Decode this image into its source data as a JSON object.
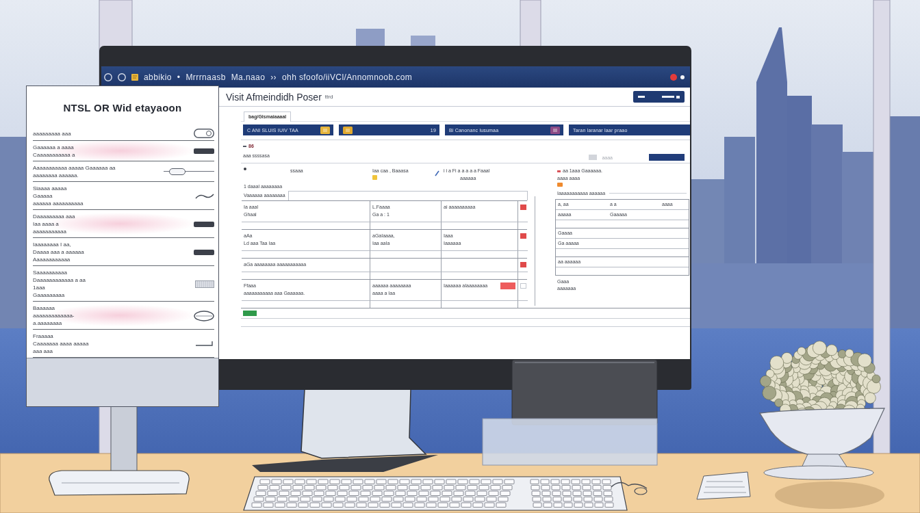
{
  "main_monitor": {
    "address_bar": {
      "segments": [
        "abbikio",
        "•",
        "Mrrrnaasb",
        "Ma.naao",
        "››",
        "ohh sfoofo/iiVCl/Annomnoob.com"
      ]
    },
    "page_title": "Visit Afmeindidh Poser",
    "title_note": "ttrd",
    "tabs": [
      {
        "label": "bag/Glsmaiaaaal",
        "selected": true
      }
    ],
    "header_bars": [
      {
        "label": "C ANI SLUIS IUIV TAA",
        "color": "#e5b43c",
        "kind": "label_icon"
      },
      {
        "label": "19",
        "color": "#e0a92e",
        "kind": "icon_label"
      },
      {
        "label": "Bl Canonanc lusumaa",
        "color": "#8c4a85",
        "kind": "label_icon"
      },
      {
        "label": "Taran laranar laar praao",
        "kind": "label"
      }
    ],
    "summary": {
      "marker": "86",
      "text": "aaa ssssasa",
      "link": "aaaa"
    },
    "form": {
      "intro": {
        "label": "ssaaa",
        "heading": "Iaa caa , Baaasa",
        "note": "i i a Fi a a a a a Faaal",
        "note_sub": "aaaaaa",
        "line": "1 daaal aaaaaaaa",
        "field_label": "Vaaaaaa aaaaaaaa"
      },
      "blocks": [
        {
          "flagged": true,
          "highlight_swatch": false,
          "cells": [
            [
              "Ia aaal",
              "Ghaal"
            ],
            [
              "L.Faaaa",
              "Ga a : 1"
            ],
            [
              "ai aaaaaaaaaa"
            ]
          ]
        },
        {
          "flagged": true,
          "highlight_swatch": false,
          "cells": [
            [
              "aAa",
              "Ld aaa Taa Iaa"
            ],
            [
              "aGaIaaaa,",
              "Iaa aaIa"
            ],
            [
              "Iaaa",
              "Iaaaaaa"
            ]
          ]
        },
        {
          "flagged": true,
          "highlight_swatch": false,
          "cells": [
            [
              "aGa aaaaaaaa aaaaaaaaaaa"
            ]
          ]
        },
        {
          "flagged": false,
          "highlight_swatch": true,
          "cells": [
            [
              "Ffaaa",
              "aaaaaaaaaaa aaa Gaaaaaa."
            ],
            [
              "aaaaaa aaaaaaaa",
              "aaaa a Iaa"
            ],
            [
              "Iaaaaaa aIaaaaaaaa"
            ]
          ]
        }
      ]
    },
    "side_panel": {
      "header": [
        "aa 1aaa Gaaaaaa.",
        "aaaa aaaa"
      ],
      "field_label": "Iaaaaaaaaaaa aaaaaa",
      "blocks": [
        {
          "rows": [
            [
              "a, aa",
              "a a",
              "aaaa"
            ],
            [
              "aaaaa",
              "Gaaaaa"
            ]
          ]
        },
        {
          "rows": [
            [
              "Gaaaa"
            ],
            [
              "Ga aaaaa"
            ]
          ]
        },
        {
          "rows": [
            [
              "aa aaaaaa"
            ]
          ]
        }
      ],
      "footer": [
        "Gaaa",
        "aaaaaaa"
      ]
    }
  },
  "side_monitor": {
    "title": "NTSL OR Wid etayaoon",
    "items": [
      {
        "lines": [
          "aaaaaaaaa aaa"
        ],
        "kind": "pill",
        "highlighted": false
      },
      {
        "lines": [
          "Gaaaaaa a aaaa",
          "Caaaaaaaaaaa a"
        ],
        "kind": "bar",
        "highlighted": true
      },
      {
        "lines": [
          "Aaaaaaaaaaa aaaaa Gaaaaaa aa",
          "aaaaaaaa aaaaaa."
        ],
        "kind": "slider",
        "level": 0.15,
        "highlighted": false
      },
      {
        "lines": [
          "Siaaaa aaaaa",
          "Gaaaaa",
          "aaaaaa aaaaaaaaaa"
        ],
        "kind": "curve",
        "highlighted": false
      },
      {
        "lines": [
          "Daaaaaaaaa aaa",
          "Iaa aaaa a",
          "aaaaaaaaaaa"
        ],
        "kind": "bar",
        "highlighted": true
      },
      {
        "lines": [
          "Iaaaaaaaa I aa,",
          "Daaaa aaa a aaaaaa",
          "Aaaaaaaaaaaa"
        ],
        "kind": "bar",
        "highlighted": false
      },
      {
        "lines": [
          "Saaaaaaaaaa",
          "Daaaaaaaaaaaa a aa",
          "1aaa",
          "Gaaaaaaaaa"
        ],
        "kind": "chip",
        "highlighted": false
      },
      {
        "lines": [
          "Baaaaaa",
          "aaaaaaaaaaaaa-",
          "a.aaaaaaaa"
        ],
        "kind": "oval",
        "highlighted": true
      },
      {
        "lines": [
          "Fraaaaa",
          "Caaaaaaa aaaa aaaaa",
          "aaa aaa"
        ],
        "kind": "handle",
        "highlighted": false
      }
    ]
  }
}
